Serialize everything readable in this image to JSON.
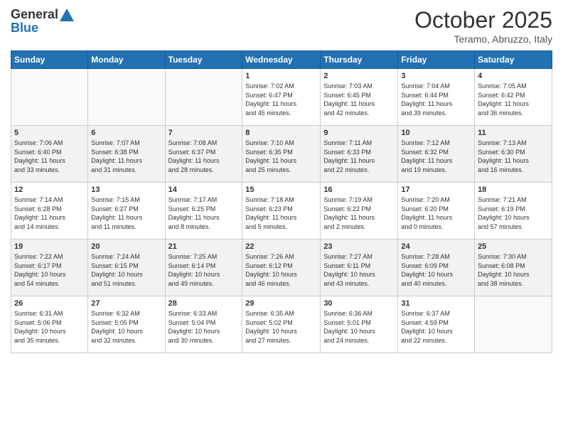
{
  "header": {
    "logo_general": "General",
    "logo_blue": "Blue",
    "month_title": "October 2025",
    "location": "Teramo, Abruzzo, Italy"
  },
  "days_of_week": [
    "Sunday",
    "Monday",
    "Tuesday",
    "Wednesday",
    "Thursday",
    "Friday",
    "Saturday"
  ],
  "weeks": [
    {
      "alt": false,
      "days": [
        {
          "num": "",
          "info": ""
        },
        {
          "num": "",
          "info": ""
        },
        {
          "num": "",
          "info": ""
        },
        {
          "num": "1",
          "info": "Sunrise: 7:02 AM\nSunset: 6:47 PM\nDaylight: 11 hours\nand 45 minutes."
        },
        {
          "num": "2",
          "info": "Sunrise: 7:03 AM\nSunset: 6:45 PM\nDaylight: 11 hours\nand 42 minutes."
        },
        {
          "num": "3",
          "info": "Sunrise: 7:04 AM\nSunset: 6:44 PM\nDaylight: 11 hours\nand 39 minutes."
        },
        {
          "num": "4",
          "info": "Sunrise: 7:05 AM\nSunset: 6:42 PM\nDaylight: 11 hours\nand 36 minutes."
        }
      ]
    },
    {
      "alt": true,
      "days": [
        {
          "num": "5",
          "info": "Sunrise: 7:06 AM\nSunset: 6:40 PM\nDaylight: 11 hours\nand 33 minutes."
        },
        {
          "num": "6",
          "info": "Sunrise: 7:07 AM\nSunset: 6:38 PM\nDaylight: 11 hours\nand 31 minutes."
        },
        {
          "num": "7",
          "info": "Sunrise: 7:08 AM\nSunset: 6:37 PM\nDaylight: 11 hours\nand 28 minutes."
        },
        {
          "num": "8",
          "info": "Sunrise: 7:10 AM\nSunset: 6:35 PM\nDaylight: 11 hours\nand 25 minutes."
        },
        {
          "num": "9",
          "info": "Sunrise: 7:11 AM\nSunset: 6:33 PM\nDaylight: 11 hours\nand 22 minutes."
        },
        {
          "num": "10",
          "info": "Sunrise: 7:12 AM\nSunset: 6:32 PM\nDaylight: 11 hours\nand 19 minutes."
        },
        {
          "num": "11",
          "info": "Sunrise: 7:13 AM\nSunset: 6:30 PM\nDaylight: 11 hours\nand 16 minutes."
        }
      ]
    },
    {
      "alt": false,
      "days": [
        {
          "num": "12",
          "info": "Sunrise: 7:14 AM\nSunset: 6:28 PM\nDaylight: 11 hours\nand 14 minutes."
        },
        {
          "num": "13",
          "info": "Sunrise: 7:15 AM\nSunset: 6:27 PM\nDaylight: 11 hours\nand 11 minutes."
        },
        {
          "num": "14",
          "info": "Sunrise: 7:17 AM\nSunset: 6:25 PM\nDaylight: 11 hours\nand 8 minutes."
        },
        {
          "num": "15",
          "info": "Sunrise: 7:18 AM\nSunset: 6:23 PM\nDaylight: 11 hours\nand 5 minutes."
        },
        {
          "num": "16",
          "info": "Sunrise: 7:19 AM\nSunset: 6:22 PM\nDaylight: 11 hours\nand 2 minutes."
        },
        {
          "num": "17",
          "info": "Sunrise: 7:20 AM\nSunset: 6:20 PM\nDaylight: 11 hours\nand 0 minutes."
        },
        {
          "num": "18",
          "info": "Sunrise: 7:21 AM\nSunset: 6:19 PM\nDaylight: 10 hours\nand 57 minutes."
        }
      ]
    },
    {
      "alt": true,
      "days": [
        {
          "num": "19",
          "info": "Sunrise: 7:22 AM\nSunset: 6:17 PM\nDaylight: 10 hours\nand 54 minutes."
        },
        {
          "num": "20",
          "info": "Sunrise: 7:24 AM\nSunset: 6:15 PM\nDaylight: 10 hours\nand 51 minutes."
        },
        {
          "num": "21",
          "info": "Sunrise: 7:25 AM\nSunset: 6:14 PM\nDaylight: 10 hours\nand 49 minutes."
        },
        {
          "num": "22",
          "info": "Sunrise: 7:26 AM\nSunset: 6:12 PM\nDaylight: 10 hours\nand 46 minutes."
        },
        {
          "num": "23",
          "info": "Sunrise: 7:27 AM\nSunset: 6:11 PM\nDaylight: 10 hours\nand 43 minutes."
        },
        {
          "num": "24",
          "info": "Sunrise: 7:28 AM\nSunset: 6:09 PM\nDaylight: 10 hours\nand 40 minutes."
        },
        {
          "num": "25",
          "info": "Sunrise: 7:30 AM\nSunset: 6:08 PM\nDaylight: 10 hours\nand 38 minutes."
        }
      ]
    },
    {
      "alt": false,
      "days": [
        {
          "num": "26",
          "info": "Sunrise: 6:31 AM\nSunset: 5:06 PM\nDaylight: 10 hours\nand 35 minutes."
        },
        {
          "num": "27",
          "info": "Sunrise: 6:32 AM\nSunset: 5:05 PM\nDaylight: 10 hours\nand 32 minutes."
        },
        {
          "num": "28",
          "info": "Sunrise: 6:33 AM\nSunset: 5:04 PM\nDaylight: 10 hours\nand 30 minutes."
        },
        {
          "num": "29",
          "info": "Sunrise: 6:35 AM\nSunset: 5:02 PM\nDaylight: 10 hours\nand 27 minutes."
        },
        {
          "num": "30",
          "info": "Sunrise: 6:36 AM\nSunset: 5:01 PM\nDaylight: 10 hours\nand 24 minutes."
        },
        {
          "num": "31",
          "info": "Sunrise: 6:37 AM\nSunset: 4:59 PM\nDaylight: 10 hours\nand 22 minutes."
        },
        {
          "num": "",
          "info": ""
        }
      ]
    }
  ]
}
